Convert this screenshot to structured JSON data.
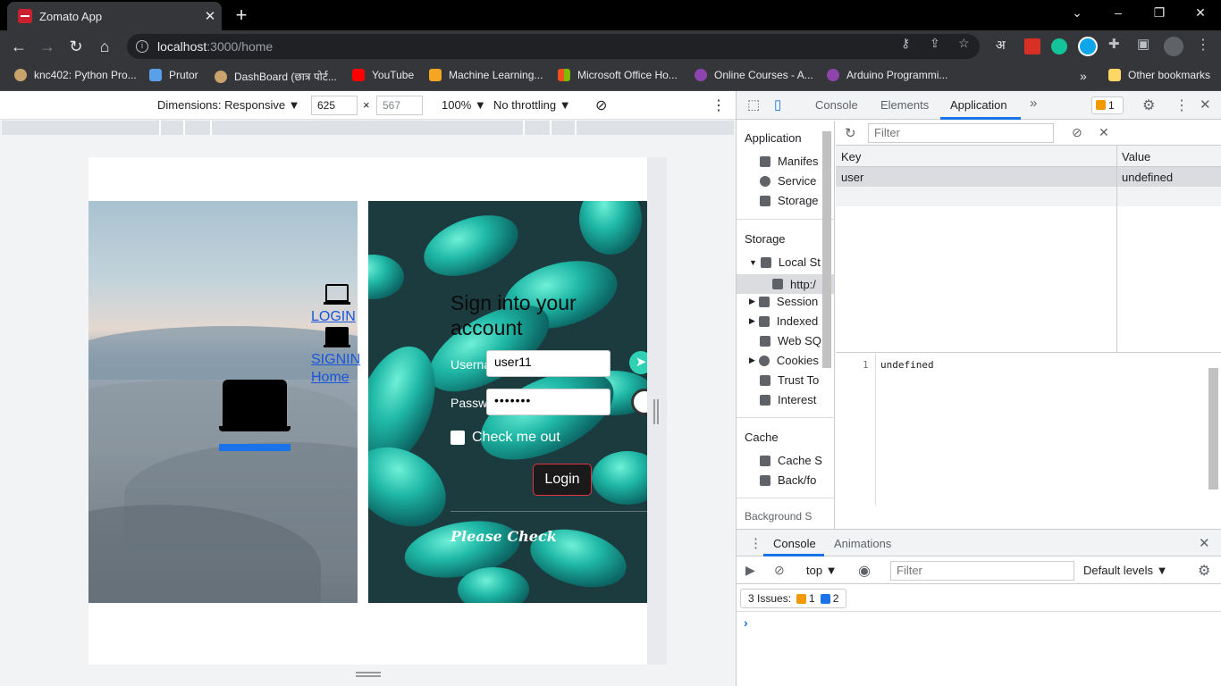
{
  "browser": {
    "tab_title": "Zomato App",
    "tab_close": "✕",
    "new_tab": "+",
    "url_host": "localhost",
    "url_path": ":3000/home",
    "window_controls": [
      "⌄",
      "–",
      "❐",
      "✕"
    ]
  },
  "bookmarks": [
    {
      "label": "knc402: Python Pro...",
      "color": "#c8a36b"
    },
    {
      "label": "Prutor",
      "color": "#5aa0e8"
    },
    {
      "label": "DashBoard (छात्र पोर्ट...",
      "color": "#c8a36b"
    },
    {
      "label": "YouTube",
      "color": "#ff0000"
    },
    {
      "label": "Machine Learning...",
      "color": "#f5a623"
    },
    {
      "label": "Microsoft Office Ho...",
      "color": "#f25022"
    },
    {
      "label": "Online Courses - A...",
      "color": "#8e44ad"
    },
    {
      "label": "Arduino Programmi...",
      "color": "#8e44ad"
    },
    {
      "label": "Other bookmarks",
      "color": "#fdd663"
    }
  ],
  "bookmarks_overflow": "»",
  "device_toolbar": {
    "dimensions_label": "Dimensions: Responsive ▼",
    "width": "625",
    "times": "×",
    "height": "567",
    "zoom": "100% ▼",
    "throttling": "No throttling ▼"
  },
  "page": {
    "nav_links": [
      "LOGIN",
      "SIGNIN",
      "Home"
    ],
    "signin_title": "Sign into your account",
    "username_label": "Userna",
    "username_value": "user11",
    "password_label": "Passw",
    "password_value": "•••••••",
    "remember_label": "Check me out",
    "login_button": "Login",
    "footer_text": "Please Check"
  },
  "devtools": {
    "tabs": [
      "Console",
      "Elements",
      "Application"
    ],
    "more_tabs": "»",
    "issues_count": "1",
    "sidebar": {
      "application_heading": "Application",
      "application_items": [
        "Manifes",
        "Service",
        "Storage"
      ],
      "storage_heading": "Storage",
      "storage_items": [
        "Local St",
        "http:/",
        "Session",
        "Indexed",
        "Web SQ",
        "Cookies",
        "Trust To",
        "Interest"
      ],
      "cache_heading": "Cache",
      "cache_items": [
        "Cache S",
        "Back/fo"
      ],
      "cut_heading": "Background S"
    },
    "filter_placeholder": "Filter",
    "table": {
      "headers": [
        "Key",
        "Value"
      ],
      "rows": [
        {
          "key": "user",
          "value": "undefined"
        }
      ]
    },
    "value_pane": {
      "line": "1",
      "content": "undefined"
    },
    "drawer": {
      "tabs": [
        "Console",
        "Animations"
      ],
      "context": "top ▼",
      "filter_placeholder": "Filter",
      "levels": "Default levels ▼",
      "issues_label": "3 Issues:",
      "issues_warn": "1",
      "issues_info": "2",
      "prompt": "›"
    }
  }
}
